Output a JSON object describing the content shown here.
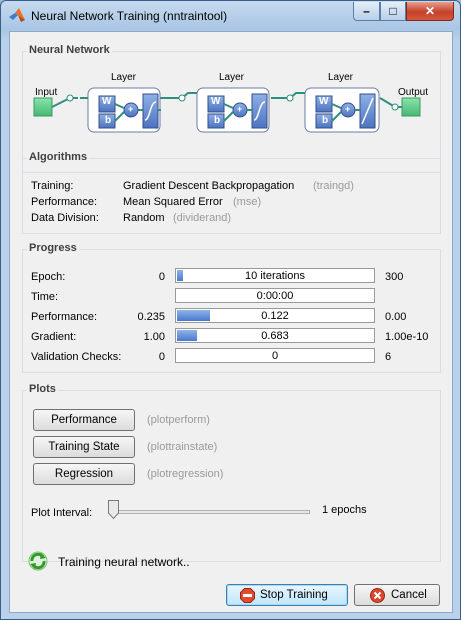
{
  "window": {
    "title": "Neural Network Training (nntraintool)",
    "controls": {
      "min": "–",
      "max": "□",
      "close": "✕"
    }
  },
  "network": {
    "section_title": "Neural Network",
    "input_label": "Input",
    "output_label": "Output",
    "layers": [
      {
        "label": "Layer",
        "w": "W",
        "b": "b",
        "plus": "+"
      },
      {
        "label": "Layer",
        "w": "W",
        "b": "b",
        "plus": "+"
      },
      {
        "label": "Layer",
        "w": "W",
        "b": "b",
        "plus": "+"
      }
    ],
    "colors": {
      "input": "#5fce8a",
      "node": "#5f86c9",
      "line": "#2e8f7c"
    }
  },
  "algorithms": {
    "section_title": "Algorithms",
    "rows": [
      {
        "label": "Training:",
        "value": "Gradient Descent Backpropagation",
        "note": "(traingd)"
      },
      {
        "label": "Performance:",
        "value": "Mean Squared Error",
        "note": "(mse)"
      },
      {
        "label": "Data Division:",
        "value": "Random",
        "note": "(dividerand)"
      }
    ]
  },
  "progress": {
    "section_title": "Progress",
    "rows": [
      {
        "label": "Epoch:",
        "start": "0",
        "value": "10 iterations",
        "end": "300",
        "fill": 0.033
      },
      {
        "label": "Time:",
        "start": "",
        "value": "0:00:00",
        "end": "",
        "fill": 0
      },
      {
        "label": "Performance:",
        "start": "0.235",
        "value": "0.122",
        "end": "0.00",
        "fill": 0.17
      },
      {
        "label": "Gradient:",
        "start": "1.00",
        "value": "0.683",
        "end": "1.00e-10",
        "fill": 0.1
      },
      {
        "label": "Validation Checks:",
        "start": "0",
        "value": "0",
        "end": "6",
        "fill": 0
      }
    ]
  },
  "plots": {
    "section_title": "Plots",
    "buttons": [
      {
        "label": "Performance",
        "note": "(plotperform)"
      },
      {
        "label": "Training State",
        "note": "(plottrainstate)"
      },
      {
        "label": "Regression",
        "note": "(plotregression)"
      }
    ],
    "interval_label": "Plot Interval:",
    "interval_value": "1 epochs",
    "interval_level": 0
  },
  "status": {
    "text": "Training neural network.."
  },
  "footer": {
    "stop_label": "Stop Training",
    "cancel_label": "Cancel"
  }
}
